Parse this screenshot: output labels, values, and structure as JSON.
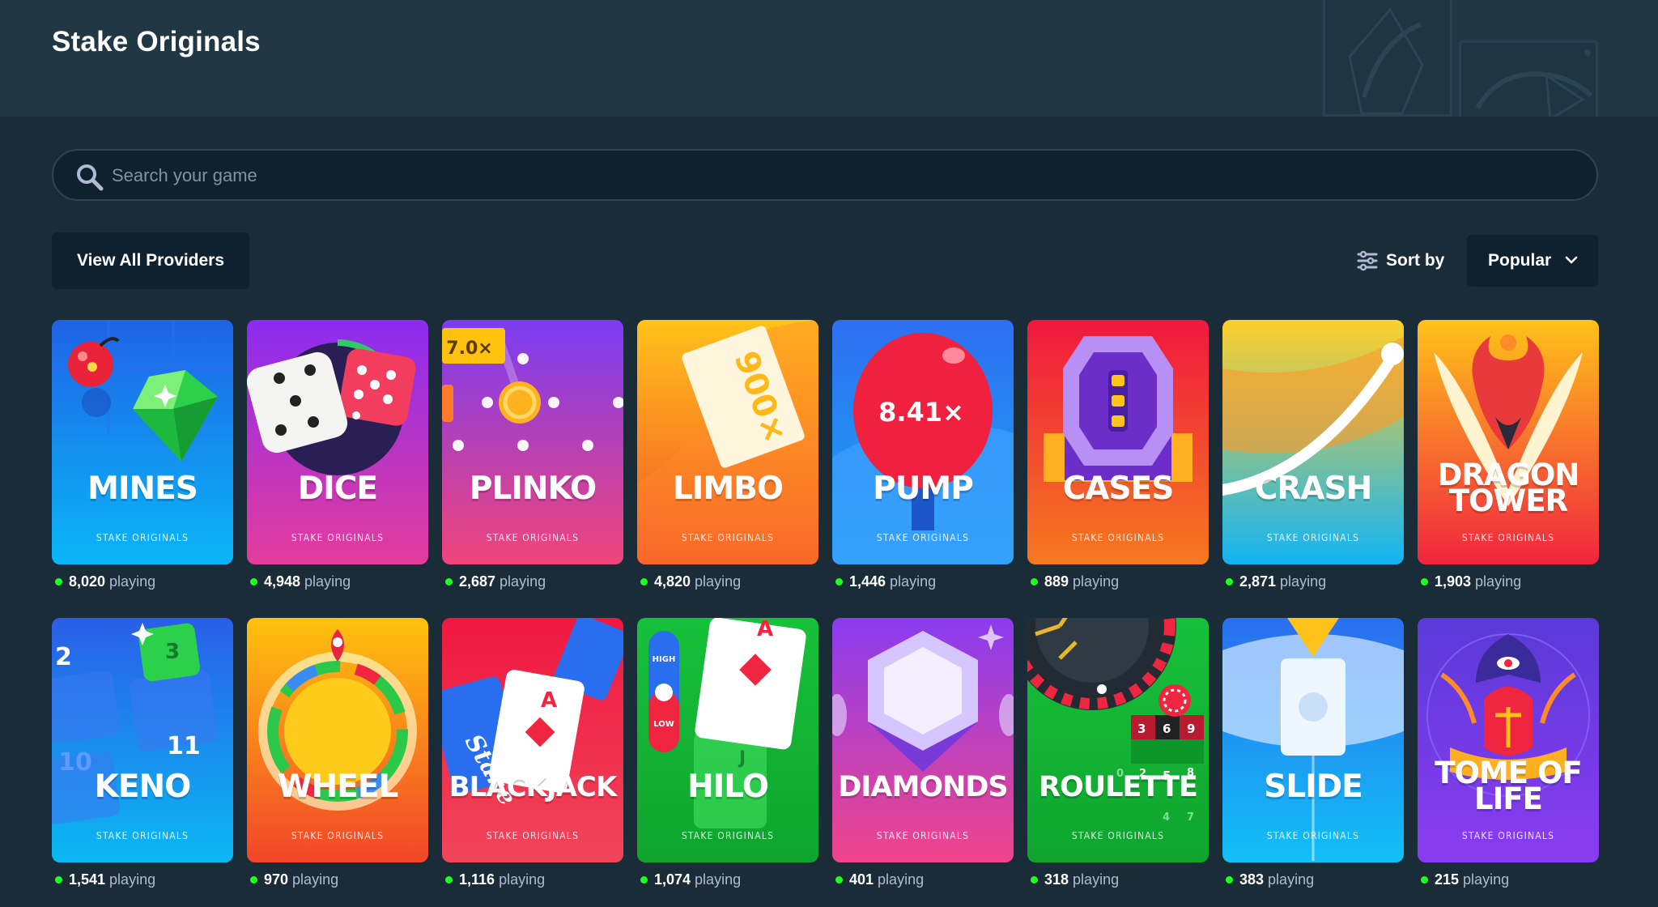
{
  "page": {
    "title": "Stake Originals"
  },
  "search": {
    "placeholder": "Search your game",
    "value": ""
  },
  "filters": {
    "providers_label": "View All Providers",
    "sort_label": "Sort by",
    "sort_value": "Popular"
  },
  "games": [
    {
      "name": "MINES",
      "subtitle": "STAKE ORIGINALS",
      "players": "8,020",
      "playing_label": "playing"
    },
    {
      "name": "DICE",
      "subtitle": "STAKE ORIGINALS",
      "players": "4,948",
      "playing_label": "playing"
    },
    {
      "name": "PLINKO",
      "subtitle": "STAKE ORIGINALS",
      "players": "2,687",
      "playing_label": "playing",
      "badge": "7.0×"
    },
    {
      "name": "LIMBO",
      "subtitle": "STAKE ORIGINALS",
      "players": "4,820",
      "playing_label": "playing",
      "badge": "900×"
    },
    {
      "name": "PUMP",
      "subtitle": "STAKE ORIGINALS",
      "players": "1,446",
      "playing_label": "playing",
      "badge": "8.41×"
    },
    {
      "name": "CASES",
      "subtitle": "STAKE ORIGINALS",
      "players": "889",
      "playing_label": "playing"
    },
    {
      "name": "CRASH",
      "subtitle": "STAKE ORIGINALS",
      "players": "2,871",
      "playing_label": "playing"
    },
    {
      "name_lines": [
        "DRAGON",
        "TOWER"
      ],
      "subtitle": "STAKE ORIGINALS",
      "players": "1,903",
      "playing_label": "playing"
    },
    {
      "name": "KENO",
      "subtitle": "STAKE ORIGINALS",
      "players": "1,541",
      "playing_label": "playing",
      "numbers": [
        "2",
        "3",
        "10",
        "11"
      ]
    },
    {
      "name": "WHEEL",
      "subtitle": "STAKE ORIGINALS",
      "players": "970",
      "playing_label": "playing"
    },
    {
      "name": "BLACKJACK",
      "subtitle": "STAKE ORIGINALS",
      "players": "1,116",
      "playing_label": "playing",
      "card_rank": "A",
      "brand": "Stake"
    },
    {
      "name": "HILO",
      "subtitle": "STAKE ORIGINALS",
      "players": "1,074",
      "playing_label": "playing",
      "card_rank": "A",
      "card_rank_2": "J",
      "high_label": "HIGH",
      "low_label": "LOW"
    },
    {
      "name": "DIAMONDS",
      "subtitle": "STAKE ORIGINALS",
      "players": "401",
      "playing_label": "playing"
    },
    {
      "name": "ROULETTE",
      "subtitle": "STAKE ORIGINALS",
      "players": "318",
      "playing_label": "playing",
      "numbers": [
        "3",
        "6",
        "9",
        "5",
        "8",
        "4",
        "7",
        "0",
        "2"
      ]
    },
    {
      "name": "SLIDE",
      "subtitle": "STAKE ORIGINALS",
      "players": "383",
      "playing_label": "playing"
    },
    {
      "name_lines": [
        "TOME OF",
        "LIFE"
      ],
      "subtitle": "STAKE ORIGINALS",
      "players": "215",
      "playing_label": "playing"
    }
  ],
  "colors": {
    "background": "#1a2c38",
    "header": "#213743",
    "input": "#0f212e",
    "online_dot": "#1fff20",
    "muted_text": "#b1bad3"
  }
}
